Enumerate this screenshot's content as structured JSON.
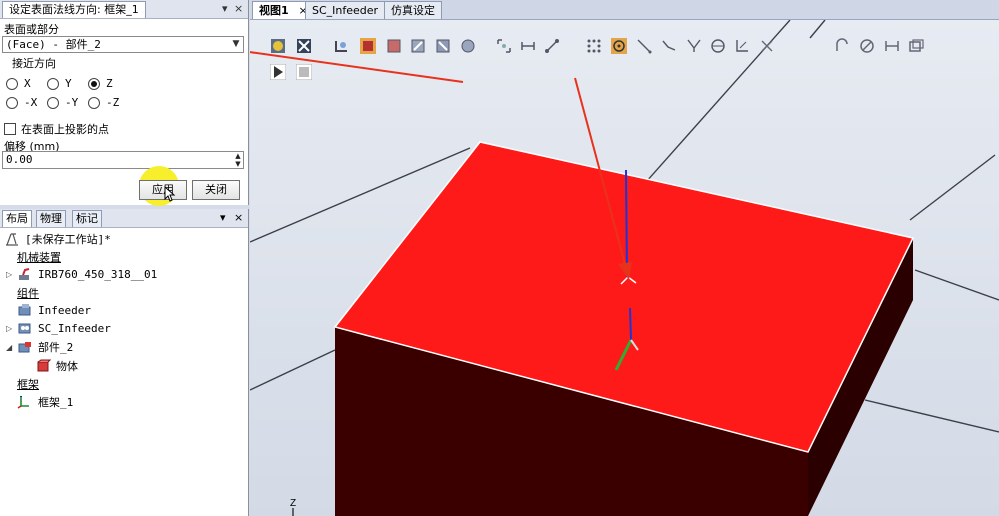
{
  "dialog": {
    "title": "设定表面法线方向: 框架_1",
    "pin": "▾",
    "close": "×",
    "surface_label": "表面或部分",
    "surface_value": "(Face) - 部件_2",
    "approach_label": "接近方向",
    "directions": [
      "X",
      "Y",
      "Z",
      "-X",
      "-Y",
      "-Z"
    ],
    "selected_direction": "Z",
    "project_label": "在表面上投影的点",
    "offset_label": "偏移 (mm)",
    "offset_value": "0.00",
    "apply": "应用",
    "close_btn": "关闭"
  },
  "layout_panel": {
    "tabs": [
      "布局",
      "物理",
      "标记"
    ],
    "pin": "▾",
    "close": "×",
    "station": "[未保存工作站]*",
    "mechanisms_label": "机械装置",
    "robot": "IRB760_450_318__01",
    "components_label": "组件",
    "infeeder": "Infeeder",
    "sc_infeeder": "SC_Infeeder",
    "part": "部件_2",
    "body": "物体",
    "frames_label": "框架",
    "frame": "框架_1"
  },
  "view_tabs": [
    {
      "label": "视图1",
      "close": "×"
    },
    {
      "label": "SC_Infeeder"
    },
    {
      "label": "仿真设定"
    }
  ],
  "viewport": {
    "axis_label": "Z",
    "box_top_color": "#ff1a1a",
    "box_side_color": "#3a0000"
  },
  "colors": {
    "annotation_arrow": "#e8321c",
    "highlight": "#f7ee2c"
  }
}
